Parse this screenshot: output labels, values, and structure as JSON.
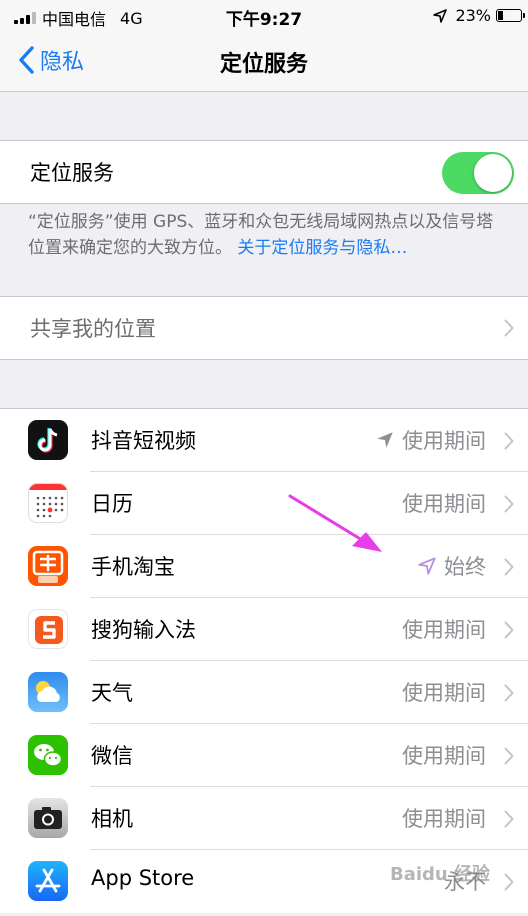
{
  "status_bar": {
    "carrier": "中国电信",
    "network": "4G",
    "time": "下午9:27",
    "battery": "23%"
  },
  "nav": {
    "back_label": "隐私",
    "title": "定位服务"
  },
  "location_services": {
    "label": "定位服务",
    "enabled": true,
    "description": "“定位服务”使用 GPS、蓝牙和众包无线局域网热点以及信号塔位置来确定您的大致方位。",
    "link": "关于定位服务与隐私…"
  },
  "share_location": {
    "label": "共享我的位置"
  },
  "apps": [
    {
      "name": "抖音短视频",
      "status": "使用期间",
      "icon": "douyin-icon",
      "recent_location": true
    },
    {
      "name": "日历",
      "status": "使用期间",
      "icon": "calendar-icon"
    },
    {
      "name": "手机淘宝",
      "status": "始终",
      "icon": "taobao-icon",
      "recent_location": true
    },
    {
      "name": "搜狗输入法",
      "status": "使用期间",
      "icon": "sogou-icon"
    },
    {
      "name": "天气",
      "status": "使用期间",
      "icon": "weather-icon"
    },
    {
      "name": "微信",
      "status": "使用期间",
      "icon": "wechat-icon"
    },
    {
      "name": "相机",
      "status": "使用期间",
      "icon": "camera-icon"
    },
    {
      "name": "App Store",
      "status": "永不",
      "icon": "appstore-icon"
    }
  ],
  "colors": {
    "accent": "#1a7cf2",
    "toggle_on": "#4cd964",
    "annotation": "#e83ce8"
  },
  "watermark": "Baidu 经验"
}
